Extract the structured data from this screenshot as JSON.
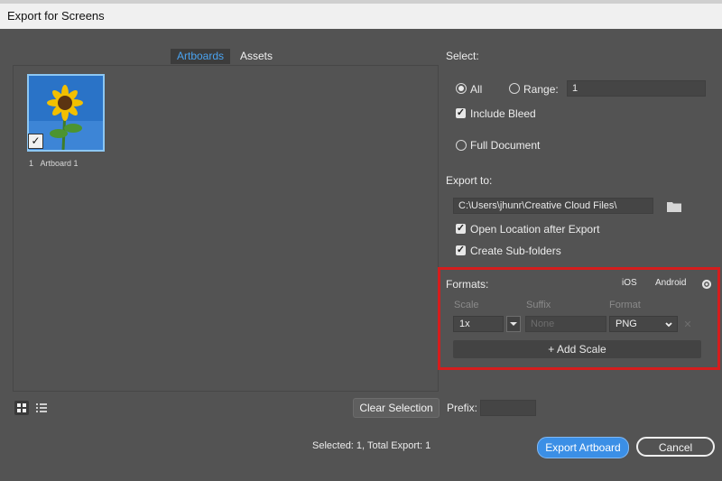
{
  "window": {
    "title": "Export for Screens"
  },
  "tabs": [
    {
      "label": "Artboards"
    },
    {
      "label": "Assets"
    }
  ],
  "artboard": {
    "index": "1",
    "name": "Artboard 1",
    "checked": true
  },
  "left_footer": {
    "clear_selection": "Clear Selection"
  },
  "select_section": {
    "label": "Select:",
    "all_label": "All",
    "range_label": "Range:",
    "range_value": "1",
    "include_bleed_label": "Include Bleed",
    "full_document_label": "Full Document"
  },
  "export_to": {
    "label": "Export to:",
    "path": "C:\\Users\\jhunr\\Creative Cloud Files\\",
    "open_location_label": "Open Location after Export",
    "create_subfolders_label": "Create Sub-folders"
  },
  "formats": {
    "label": "Formats:",
    "ios_label": "iOS",
    "android_label": "Android",
    "scale_header": "Scale",
    "suffix_header": "Suffix",
    "format_header": "Format",
    "scale_value": "1x",
    "suffix_placeholder": "None",
    "format_value": "PNG",
    "add_scale_label": "Add Scale"
  },
  "prefix": {
    "label": "Prefix:",
    "value": ""
  },
  "summary": {
    "text": "Selected: 1, Total Export: 1"
  },
  "buttons": {
    "export_label": "Export Artboard",
    "cancel_label": "Cancel"
  },
  "colors": {
    "accent": "#3b8fe6",
    "highlight_box": "#d51d1d",
    "dialog_bg": "#535353"
  },
  "icons": {
    "folder": "folder-icon",
    "gear": "gear-icon",
    "grid_view": "grid-view-icon",
    "list_view": "list-view-icon",
    "dropdown": "chevron-down-icon",
    "close": "close-icon",
    "add": "plus-icon"
  }
}
